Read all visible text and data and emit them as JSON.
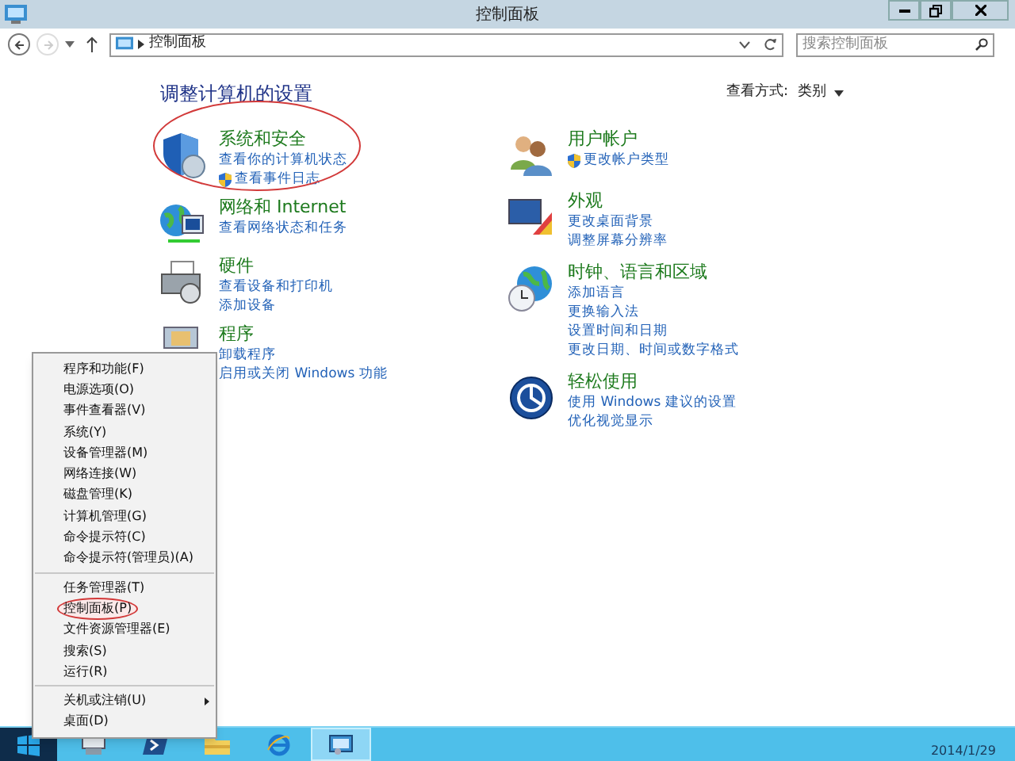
{
  "window": {
    "title": "控制面板"
  },
  "address_bar": {
    "path": "控制面板",
    "back_disabled": false,
    "forward_disabled": true
  },
  "search": {
    "placeholder": "搜索控制面板"
  },
  "heading": "调整计算机的设置",
  "view_by": {
    "label": "查看方式:",
    "value": "类别"
  },
  "columns": [
    [
      {
        "title": "系统和安全",
        "highlighted": true,
        "links": [
          {
            "text": "查看你的计算机状态",
            "shield": false
          },
          {
            "text": "查看事件日志",
            "shield": true
          }
        ]
      },
      {
        "title": "网络和 Internet",
        "highlighted": false,
        "links": [
          {
            "text": "查看网络状态和任务",
            "shield": false
          }
        ]
      },
      {
        "title": "硬件",
        "highlighted": false,
        "links": [
          {
            "text": "查看设备和打印机",
            "shield": false
          },
          {
            "text": "添加设备",
            "shield": false
          }
        ]
      },
      {
        "title": "程序",
        "highlighted": false,
        "links": [
          {
            "text": "卸载程序",
            "shield": false
          },
          {
            "text": "启用或关闭 Windows 功能",
            "shield": false
          }
        ]
      }
    ],
    [
      {
        "title": "用户帐户",
        "highlighted": false,
        "links": [
          {
            "text": "更改帐户类型",
            "shield": true
          }
        ]
      },
      {
        "title": "外观",
        "highlighted": false,
        "links": [
          {
            "text": "更改桌面背景",
            "shield": false
          },
          {
            "text": "调整屏幕分辨率",
            "shield": false
          }
        ]
      },
      {
        "title": "时钟、语言和区域",
        "highlighted": false,
        "links": [
          {
            "text": "添加语言",
            "shield": false
          },
          {
            "text": "更换输入法",
            "shield": false
          },
          {
            "text": "设置时间和日期",
            "shield": false
          },
          {
            "text": "更改日期、时间或数字格式",
            "shield": false
          }
        ]
      },
      {
        "title": "轻松使用",
        "highlighted": false,
        "links": [
          {
            "text": "使用 Windows 建议的设置",
            "shield": false
          },
          {
            "text": "优化视觉显示",
            "shield": false
          }
        ]
      }
    ]
  ],
  "context_menu": [
    [
      {
        "label": "程序和功能(F)",
        "highlighted": false,
        "submenu": false
      },
      {
        "label": "电源选项(O)",
        "highlighted": false,
        "submenu": false
      },
      {
        "label": "事件查看器(V)",
        "highlighted": false,
        "submenu": false
      },
      {
        "label": "系统(Y)",
        "highlighted": false,
        "submenu": false
      },
      {
        "label": "设备管理器(M)",
        "highlighted": false,
        "submenu": false
      },
      {
        "label": "网络连接(W)",
        "highlighted": false,
        "submenu": false
      },
      {
        "label": "磁盘管理(K)",
        "highlighted": false,
        "submenu": false
      },
      {
        "label": "计算机管理(G)",
        "highlighted": false,
        "submenu": false
      },
      {
        "label": "命令提示符(C)",
        "highlighted": false,
        "submenu": false
      },
      {
        "label": "命令提示符(管理员)(A)",
        "highlighted": false,
        "submenu": false
      }
    ],
    [
      {
        "label": "任务管理器(T)",
        "highlighted": false,
        "submenu": false
      },
      {
        "label": "控制面板(P)",
        "highlighted": true,
        "submenu": false
      },
      {
        "label": "文件资源管理器(E)",
        "highlighted": false,
        "submenu": false
      },
      {
        "label": "搜索(S)",
        "highlighted": false,
        "submenu": false
      },
      {
        "label": "运行(R)",
        "highlighted": false,
        "submenu": false
      }
    ],
    [
      {
        "label": "关机或注销(U)",
        "highlighted": false,
        "submenu": true
      },
      {
        "label": "桌面(D)",
        "highlighted": false,
        "submenu": false
      }
    ]
  ],
  "taskbar": {
    "apps": [
      {
        "selected": false
      },
      {
        "selected": false
      },
      {
        "selected": false
      },
      {
        "selected": false
      },
      {
        "selected": true
      }
    ],
    "date": "2014/1/29"
  }
}
